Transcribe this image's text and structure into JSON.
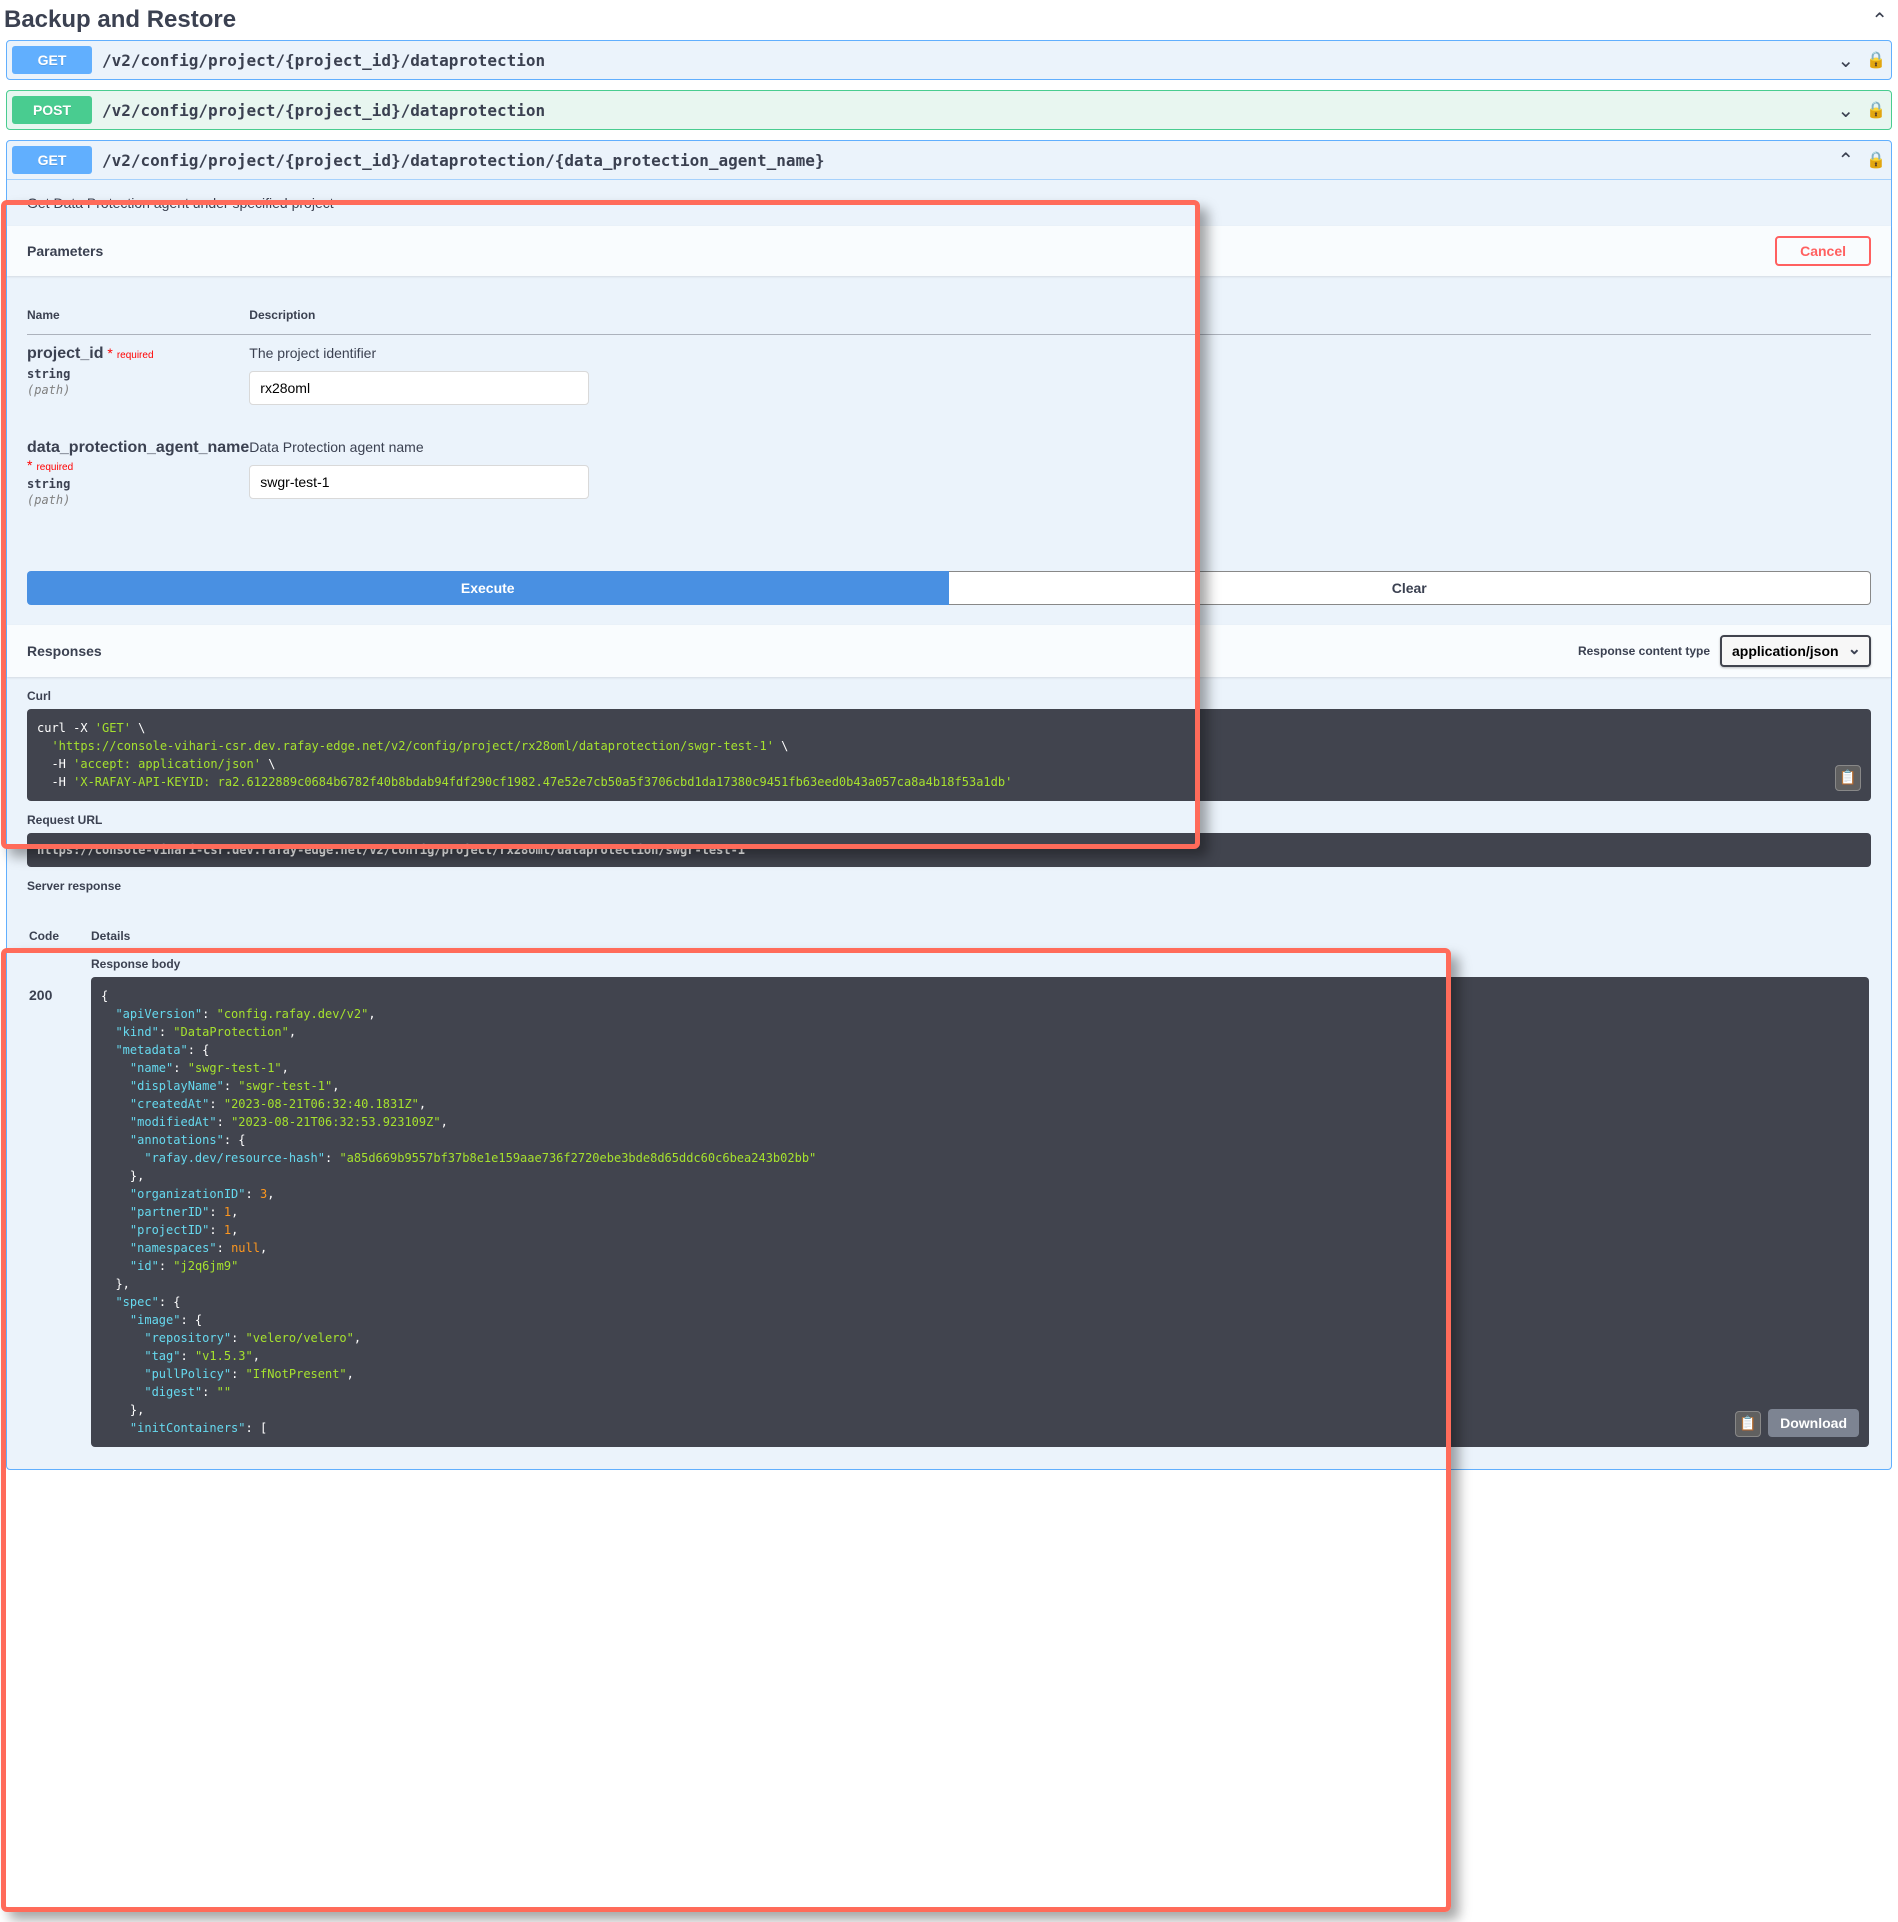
{
  "section": {
    "title": "Backup and Restore"
  },
  "ops": {
    "get1": {
      "method": "GET",
      "path": "/v2/config/project/{project_id}/dataprotection"
    },
    "post1": {
      "method": "POST",
      "path": "/v2/config/project/{project_id}/dataprotection"
    },
    "get2": {
      "method": "GET",
      "path": "/v2/config/project/{project_id}/dataprotection/{data_protection_agent_name}"
    }
  },
  "expanded": {
    "summary": "Get Data Protection agent under specified project",
    "paramsTitle": "Parameters",
    "cancel": "Cancel",
    "colName": "Name",
    "colDesc": "Description",
    "params": [
      {
        "name": "project_id",
        "required": "required",
        "type": "string",
        "in": "(path)",
        "desc": "The project identifier",
        "value": "rx28oml"
      },
      {
        "name": "data_protection_agent_name",
        "required": "required",
        "type": "string",
        "in": "(path)",
        "desc": "Data Protection agent name",
        "value": "swgr-test-1"
      }
    ],
    "execute": "Execute",
    "clear": "Clear"
  },
  "responses": {
    "title": "Responses",
    "ctypeLabel": "Response content type",
    "ctype": "application/json",
    "curlLabel": "Curl",
    "curl": "curl -X 'GET' \\\n  'https://console-vihari-csr.dev.rafay-edge.net/v2/config/project/rx28oml/dataprotection/swgr-test-1' \\\n  -H 'accept: application/json' \\\n  -H 'X-RAFAY-API-KEYID: ra2.6122889c0684b6782f40b8bdab94fdf290cf1982.47e52e7cb50a5f3706cbd1da17380c9451fb63eed0b43a057ca8a4b18f53a1db'",
    "reqUrlLabel": "Request URL",
    "reqUrl": "https://console-vihari-csr.dev.rafay-edge.net/v2/config/project/rx28oml/dataprotection/swgr-test-1",
    "serverRespLabel": "Server response",
    "codeCol": "Code",
    "detailsCol": "Details",
    "code": "200",
    "bodyLabel": "Response body",
    "download": "Download",
    "body": {
      "apiVersion": "config.rafay.dev/v2",
      "kind": "DataProtection",
      "metadata": {
        "name": "swgr-test-1",
        "displayName": "swgr-test-1",
        "createdAt": "2023-08-21T06:32:40.1831Z",
        "modifiedAt": "2023-08-21T06:32:53.923109Z",
        "annotations": {
          "rafay.dev/resource-hash": "a85d669b9557bf37b8e1e159aae736f2720ebe3bde8d65ddc60c6bea243b02bb"
        },
        "organizationID": 3,
        "partnerID": 1,
        "projectID": 1,
        "namespaces": null,
        "id": "j2q6jm9"
      },
      "spec": {
        "image": {
          "repository": "velero/velero",
          "tag": "v1.5.3",
          "pullPolicy": "IfNotPresent",
          "digest": ""
        },
        "initContainers": []
      }
    }
  }
}
